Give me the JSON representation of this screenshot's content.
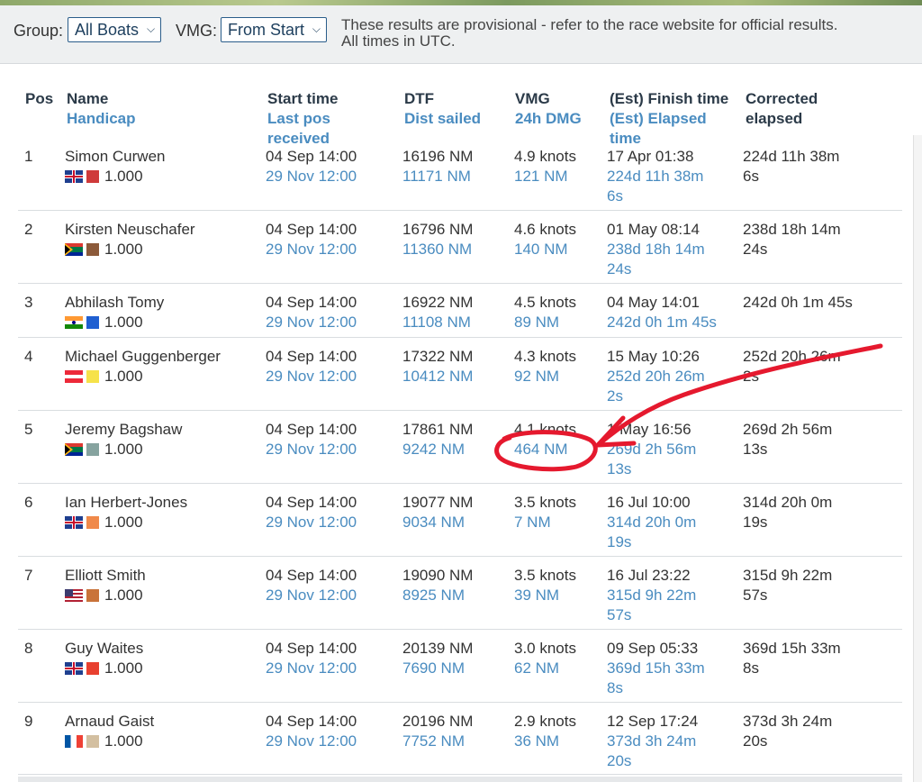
{
  "toolbar": {
    "group_label": "Group:",
    "group_value": "All Boats",
    "vmg_label": "VMG:",
    "vmg_value": "From Start",
    "notice_line1": "These results are provisional - refer to the race website for official results.",
    "notice_line2": "All times in UTC."
  },
  "headers": {
    "pos": "Pos",
    "name": "Name",
    "handicap": "Handicap",
    "start_time": "Start time",
    "last_pos_1": "Last pos",
    "last_pos_2": "received",
    "dtf": "DTF",
    "dist_sailed": "Dist sailed",
    "vmg": "VMG",
    "dmg": "24h DMG",
    "finish_time": "(Est) Finish time",
    "elapsed_1": "(Est) Elapsed",
    "elapsed_2": "time",
    "corrected_1": "Corrected",
    "corrected_2": "elapsed"
  },
  "rows": [
    {
      "pos": "1",
      "name": "Simon Curwen",
      "flag": "gb",
      "color": "#cf3a3a",
      "handicap": "1.000",
      "start": "04 Sep 14:00",
      "last_pos": "29 Nov 12:00",
      "dtf": "16196 NM",
      "sailed": "11171 NM",
      "vmg": "4.9 knots",
      "dmg": "121 NM",
      "finish": "17 Apr 01:38",
      "elapsed_a": "224d 11h 38m",
      "elapsed_b": "6s",
      "corr_a": "224d 11h 38m",
      "corr_b": "6s"
    },
    {
      "pos": "2",
      "name": "Kirsten Neuschafer",
      "flag": "za",
      "color": "#8c5a3a",
      "handicap": "1.000",
      "start": "04 Sep 14:00",
      "last_pos": "29 Nov 12:00",
      "dtf": "16796 NM",
      "sailed": "11360 NM",
      "vmg": "4.6 knots",
      "dmg": "140 NM",
      "finish": "01 May 08:14",
      "elapsed_a": "238d 18h 14m",
      "elapsed_b": "24s",
      "corr_a": "238d 18h 14m",
      "corr_b": "24s"
    },
    {
      "pos": "3",
      "name": "Abhilash Tomy",
      "flag": "in",
      "color": "#1f5fd1",
      "handicap": "1.000",
      "start": "04 Sep 14:00",
      "last_pos": "29 Nov 12:00",
      "dtf": "16922 NM",
      "sailed": "11108 NM",
      "vmg": "4.5 knots",
      "dmg": "89 NM",
      "finish": "04 May 14:01",
      "elapsed_a": "242d 0h 1m 45s",
      "elapsed_b": "",
      "corr_a": "242d 0h 1m 45s",
      "corr_b": ""
    },
    {
      "pos": "4",
      "name": "Michael Guggenberger",
      "flag": "at",
      "color": "#f6e24a",
      "handicap": "1.000",
      "start": "04 Sep 14:00",
      "last_pos": "29 Nov 12:00",
      "dtf": "17322 NM",
      "sailed": "10412 NM",
      "vmg": "4.3 knots",
      "dmg": "92 NM",
      "finish": "15 May 10:26",
      "elapsed_a": "252d 20h 26m",
      "elapsed_b": "2s",
      "corr_a": "252d 20h 26m",
      "corr_b": "2s"
    },
    {
      "pos": "5",
      "name": "Jeremy Bagshaw",
      "flag": "za",
      "color": "#86a39f",
      "handicap": "1.000",
      "start": "04 Sep 14:00",
      "last_pos": "29 Nov 12:00",
      "dtf": "17861 NM",
      "sailed": "9242 NM",
      "vmg": "4.1 knots",
      "dmg": "464 NM",
      "finish": "1 May 16:56",
      "elapsed_a": "269d 2h 56m",
      "elapsed_b": "13s",
      "corr_a": "269d 2h 56m",
      "corr_b": "13s"
    },
    {
      "pos": "6",
      "name": "Ian Herbert-Jones",
      "flag": "gb",
      "color": "#f0894a",
      "handicap": "1.000",
      "start": "04 Sep 14:00",
      "last_pos": "29 Nov 12:00",
      "dtf": "19077 NM",
      "sailed": "9034 NM",
      "vmg": "3.5 knots",
      "dmg": "7 NM",
      "finish": "16 Jul 10:00",
      "elapsed_a": "314d 20h 0m",
      "elapsed_b": "19s",
      "corr_a": "314d 20h 0m",
      "corr_b": "19s"
    },
    {
      "pos": "7",
      "name": "Elliott Smith",
      "flag": "us",
      "color": "#c9733a",
      "handicap": "1.000",
      "start": "04 Sep 14:00",
      "last_pos": "29 Nov 12:00",
      "dtf": "19090 NM",
      "sailed": "8925 NM",
      "vmg": "3.5 knots",
      "dmg": "39 NM",
      "finish": "16 Jul 23:22",
      "elapsed_a": "315d 9h 22m",
      "elapsed_b": "57s",
      "corr_a": "315d 9h 22m",
      "corr_b": "57s"
    },
    {
      "pos": "8",
      "name": "Guy Waites",
      "flag": "gb",
      "color": "#e8402f",
      "handicap": "1.000",
      "start": "04 Sep 14:00",
      "last_pos": "29 Nov 12:00",
      "dtf": "20139 NM",
      "sailed": "7690 NM",
      "vmg": "3.0 knots",
      "dmg": "62 NM",
      "finish": "09 Sep 05:33",
      "elapsed_a": "369d 15h 33m",
      "elapsed_b": "8s",
      "corr_a": "369d 15h 33m",
      "corr_b": "8s"
    },
    {
      "pos": "9",
      "name": "Arnaud Gaist",
      "flag": "fr",
      "color": "#d3bfa0",
      "handicap": "1.000",
      "start": "04 Sep 14:00",
      "last_pos": "29 Nov 12:00",
      "dtf": "20196 NM",
      "sailed": "7752 NM",
      "vmg": "2.9 knots",
      "dmg": "36 NM",
      "finish": "12 Sep 17:24",
      "elapsed_a": "373d 3h 24m",
      "elapsed_b": "20s",
      "corr_a": "373d 3h 24m",
      "corr_b": "20s"
    }
  ],
  "icons": {
    "dropdown": "chevron-down-icon"
  },
  "annotation": {
    "color": "#e5192e",
    "marks": [
      "circle",
      "arrow"
    ]
  }
}
